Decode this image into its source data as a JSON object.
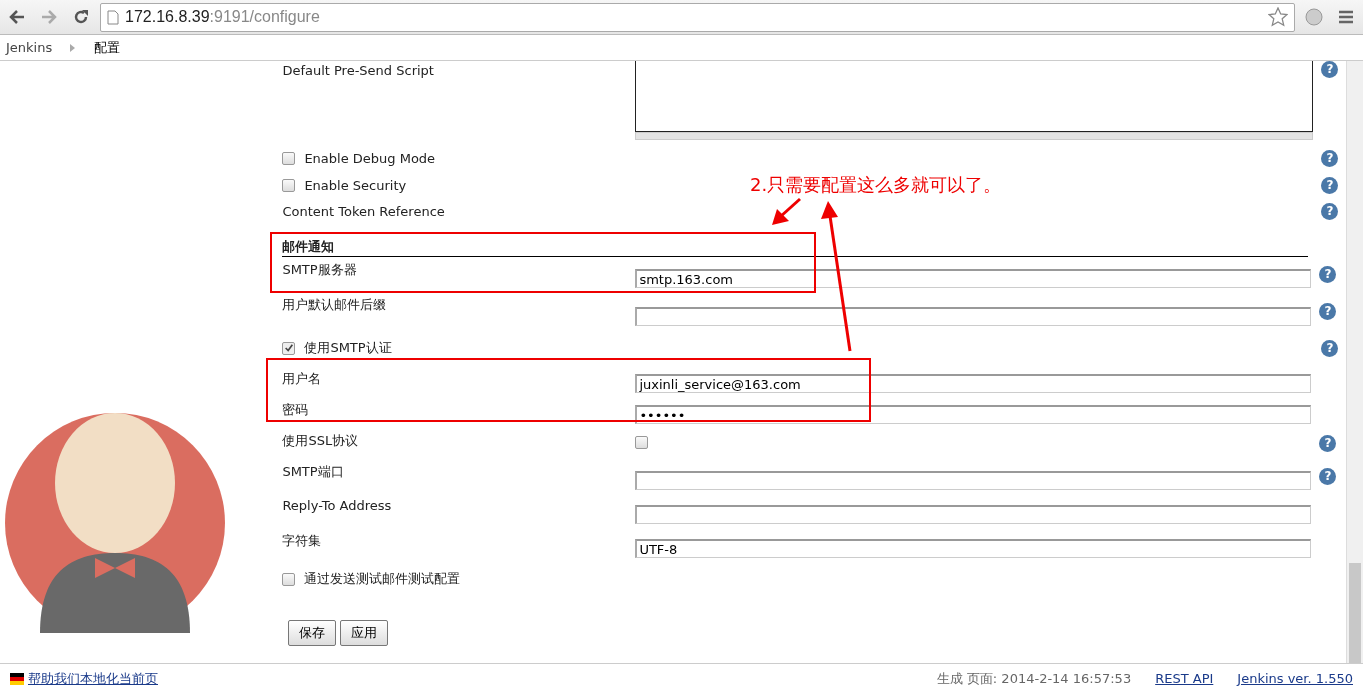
{
  "browser": {
    "url_host": "172.16.8.39",
    "url_rest": ":9191/configure"
  },
  "breadcrumb": [
    "Jenkins",
    "配置"
  ],
  "form": {
    "script_label": "Default Pre-Send Script",
    "script_help": "?",
    "options": [
      {
        "label": "Enable Debug Mode",
        "checked": false,
        "help": "?"
      },
      {
        "label": "Enable Security",
        "checked": false,
        "help": "?"
      }
    ],
    "token_label": "Content Token Reference",
    "token_help": "?",
    "section_title": "邮件通知",
    "fields": [
      {
        "kind": "text",
        "label": "SMTP服务器",
        "value": "smtp.163.com",
        "help": "?"
      },
      {
        "kind": "text",
        "label": "用户默认邮件后缀",
        "help": "?"
      },
      {
        "kind": "check",
        "label": "使用SMTP认证",
        "checked": true,
        "help": "?"
      },
      {
        "kind": "text",
        "label": "用户名",
        "value": "juxinli_service@163.com"
      },
      {
        "kind": "password",
        "label": "密码",
        "value": "••••••"
      },
      {
        "kind": "checkbox",
        "label": "使用SSL协议",
        "checked": false,
        "help": "?"
      },
      {
        "kind": "text",
        "label": "SMTP端口",
        "help": "?"
      },
      {
        "kind": "text",
        "label": "Reply-To Address"
      },
      {
        "kind": "text",
        "label": "字符集",
        "value": "UTF-8"
      },
      {
        "kind": "check",
        "label": "通过发送测试邮件测试配置",
        "checked": false
      }
    ],
    "buttons": [
      "保存",
      "应用"
    ]
  },
  "annotation": {
    "text": "2.只需要配置这么多就可以了。"
  },
  "footer": {
    "link": "帮助我们本地化当前页",
    "generated": "生成 页面: 2014-2-14 16:57:53",
    "api": "REST API",
    "version": "Jenkins ver. 1.550"
  }
}
